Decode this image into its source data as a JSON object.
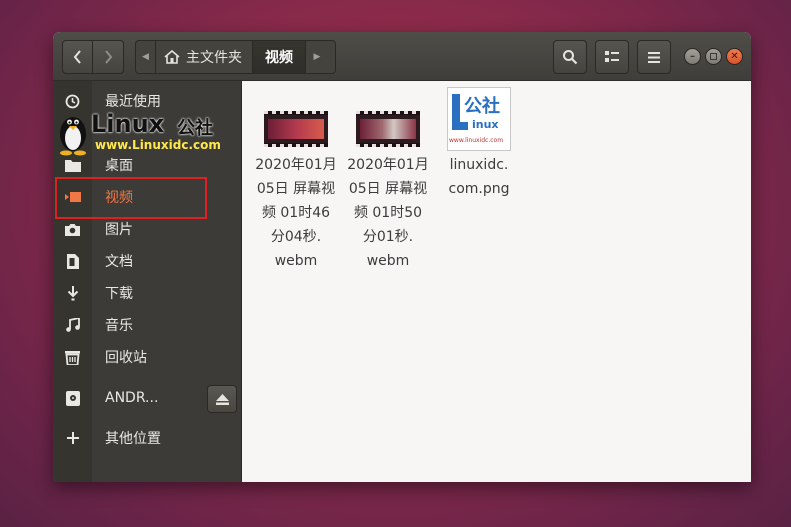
{
  "headerbar": {
    "breadcrumb": {
      "home_label": "主文件夹",
      "current_label": "视频"
    }
  },
  "sidebar": {
    "items": [
      {
        "label": "最近使用",
        "icon": "clock-icon"
      },
      {
        "label": "桌面",
        "icon": "folder-icon"
      },
      {
        "label": "视频",
        "icon": "video-icon",
        "active": true
      },
      {
        "label": "图片",
        "icon": "camera-icon"
      },
      {
        "label": "文档",
        "icon": "document-icon"
      },
      {
        "label": "下载",
        "icon": "download-icon"
      },
      {
        "label": "音乐",
        "icon": "music-icon"
      },
      {
        "label": "回收站",
        "icon": "trash-icon"
      },
      {
        "label": "ANDR...",
        "icon": "drive-icon"
      },
      {
        "label": "其他位置",
        "icon": "plus-icon"
      }
    ]
  },
  "files": [
    {
      "name_lines": [
        "2020年01月",
        "05日 屏幕视",
        "频 01时46",
        "分04秒.",
        "webm"
      ],
      "type": "video"
    },
    {
      "name_lines": [
        "2020年01月",
        "05日 屏幕视",
        "频 01时50",
        "分01秒.",
        "webm"
      ],
      "type": "video"
    },
    {
      "name_lines": [
        "linuxidc.",
        "com.png"
      ],
      "type": "image",
      "thumb_text": "公社",
      "thumb_sub": "inux",
      "thumb_url": "www.linuxidc.com"
    }
  ],
  "watermark": {
    "brand": "Linux",
    "brand_cn": "公社",
    "url": "www.Linuxidc.com"
  },
  "colors": {
    "accent": "#f07746",
    "highlight_box": "#e02020",
    "sidebar_bg": "#3c3b37"
  }
}
